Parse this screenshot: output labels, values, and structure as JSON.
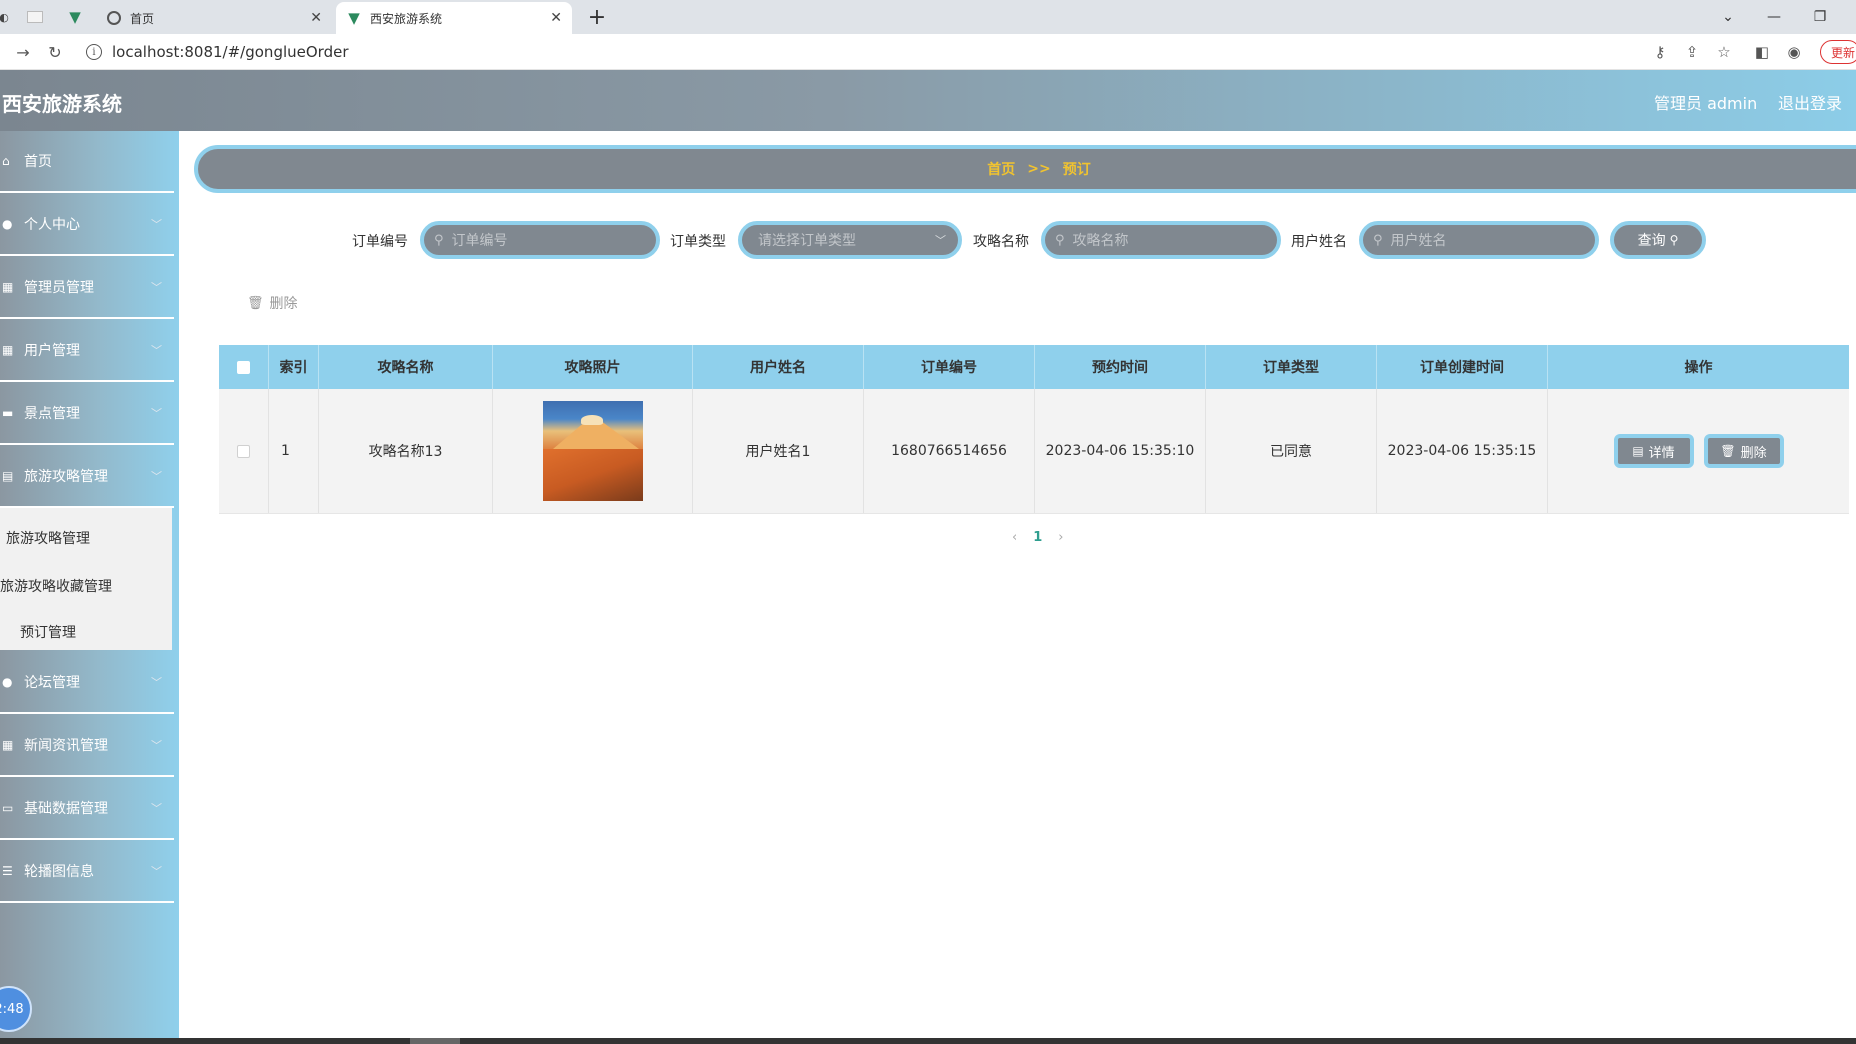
{
  "browser": {
    "tabs": [
      {
        "title": "首页"
      },
      {
        "title": "西安旅游系统"
      }
    ],
    "url": "localhost:8081/#/gonglueOrder",
    "update_label": "更新"
  },
  "header": {
    "title": "西安旅游系统",
    "admin": "管理员 admin",
    "logout": "退出登录"
  },
  "sidebar": {
    "items": [
      {
        "label": "首页",
        "icon": "home-icon"
      },
      {
        "label": "个人中心",
        "icon": "person-icon"
      },
      {
        "label": "管理员管理",
        "icon": "grid-icon"
      },
      {
        "label": "用户管理",
        "icon": "grid-icon"
      },
      {
        "label": "景点管理",
        "icon": "chat-icon"
      },
      {
        "label": "旅游攻略管理",
        "icon": "book-icon"
      },
      {
        "label": "论坛管理",
        "icon": "person-icon"
      },
      {
        "label": "新闻资讯管理",
        "icon": "grid-icon"
      },
      {
        "label": "基础数据管理",
        "icon": "print-icon"
      },
      {
        "label": "轮播图信息",
        "icon": "list-icon"
      }
    ],
    "submenu": [
      "旅游攻略管理",
      "旅游攻略收藏管理",
      "预订管理"
    ],
    "clock": "2:48"
  },
  "breadcrumb": {
    "home": "首页",
    "sep": ">>",
    "current": "预订"
  },
  "filters": {
    "order_no": {
      "label": "订单编号",
      "placeholder": "订单编号"
    },
    "order_type": {
      "label": "订单类型",
      "placeholder": "请选择订单类型"
    },
    "guide_name": {
      "label": "攻略名称",
      "placeholder": "攻略名称"
    },
    "user_name": {
      "label": "用户姓名",
      "placeholder": "用户姓名"
    },
    "query_label": "查询"
  },
  "toolbar": {
    "delete_label": "删除"
  },
  "table": {
    "columns": [
      "索引",
      "攻略名称",
      "攻略照片",
      "用户姓名",
      "订单编号",
      "预约时间",
      "订单类型",
      "订单创建时间",
      "操作"
    ],
    "rows": [
      {
        "index": "1",
        "guide_name": "攻略名称13",
        "user_name": "用户姓名1",
        "order_no": "1680766514656",
        "booking_time": "2023-04-06 15:35:10",
        "order_type": "已同意",
        "created_time": "2023-04-06 15:35:15",
        "detail_label": "详情",
        "delete_label": "删除"
      }
    ]
  },
  "pagination": {
    "current": "1"
  }
}
